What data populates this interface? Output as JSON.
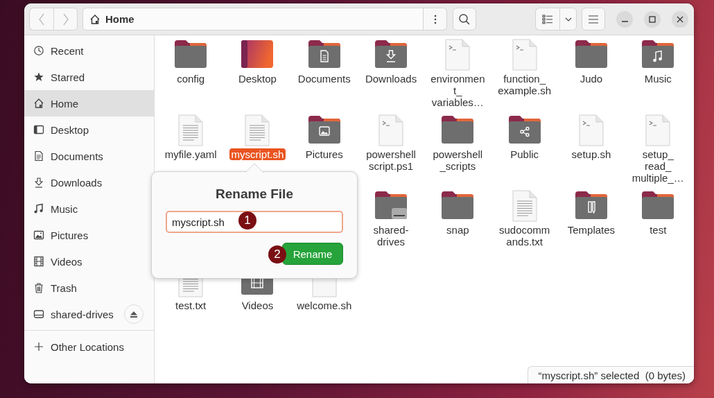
{
  "window": {
    "path": "Home"
  },
  "sidebar": {
    "items": [
      {
        "label": "Recent",
        "kind": "recent",
        "selected": false
      },
      {
        "label": "Starred",
        "kind": "starred",
        "selected": false
      },
      {
        "label": "Home",
        "kind": "home",
        "selected": true
      },
      {
        "label": "Desktop",
        "kind": "desktop",
        "selected": false
      },
      {
        "label": "Documents",
        "kind": "documents",
        "selected": false
      },
      {
        "label": "Downloads",
        "kind": "downloads",
        "selected": false
      },
      {
        "label": "Music",
        "kind": "music",
        "selected": false
      },
      {
        "label": "Pictures",
        "kind": "pictures",
        "selected": false
      },
      {
        "label": "Videos",
        "kind": "videos",
        "selected": false
      },
      {
        "label": "Trash",
        "kind": "trash",
        "selected": false
      },
      {
        "label": "shared-drives",
        "kind": "drive",
        "selected": false
      }
    ],
    "other_locations": "Other Locations"
  },
  "files": [
    {
      "name": "config",
      "kind": "folder",
      "selected": false
    },
    {
      "name": "Desktop",
      "kind": "desktop",
      "selected": false
    },
    {
      "name": "Documents",
      "kind": "documents",
      "selected": false
    },
    {
      "name": "Downloads",
      "kind": "downloads",
      "selected": false
    },
    {
      "name": "environmen\nt_\nvariables…",
      "kind": "script",
      "selected": false
    },
    {
      "name": "function_\nexample.sh",
      "kind": "script",
      "selected": false
    },
    {
      "name": "Judo",
      "kind": "folder",
      "selected": false
    },
    {
      "name": "Music",
      "kind": "music",
      "selected": false
    },
    {
      "name": "myfile.yaml",
      "kind": "text",
      "selected": false
    },
    {
      "name": "myscript.sh",
      "kind": "text",
      "selected": true
    },
    {
      "name": "Pictures",
      "kind": "pictures",
      "selected": false
    },
    {
      "name": "powershell\nscript.ps1",
      "kind": "script",
      "selected": false
    },
    {
      "name": "powershell\n_scripts",
      "kind": "folder",
      "selected": false
    },
    {
      "name": "Public",
      "kind": "public",
      "selected": false
    },
    {
      "name": "setup.sh",
      "kind": "script",
      "selected": false
    },
    {
      "name": "setup_\nread_\nmultiple_…",
      "kind": "script",
      "selected": false
    },
    {
      "name": "shared-\ndrives",
      "kind": "drive",
      "selected": false
    },
    {
      "name": "snap",
      "kind": "folder",
      "selected": false
    },
    {
      "name": "sudocomm\nands.txt",
      "kind": "text",
      "selected": false
    },
    {
      "name": "Templates",
      "kind": "templates",
      "selected": false
    },
    {
      "name": "test",
      "kind": "folder",
      "selected": false
    },
    {
      "name": "test.txt",
      "kind": "text",
      "selected": false
    },
    {
      "name": "Videos",
      "kind": "videos",
      "selected": false
    },
    {
      "name": "welcome.sh",
      "kind": "script",
      "selected": false
    }
  ],
  "rename_popover": {
    "title": "Rename File",
    "value": "myscript.sh",
    "button": "Rename"
  },
  "annotations": [
    "1",
    "2"
  ],
  "status_bar": "“myscript.sh” selected  (0 bytes)"
}
